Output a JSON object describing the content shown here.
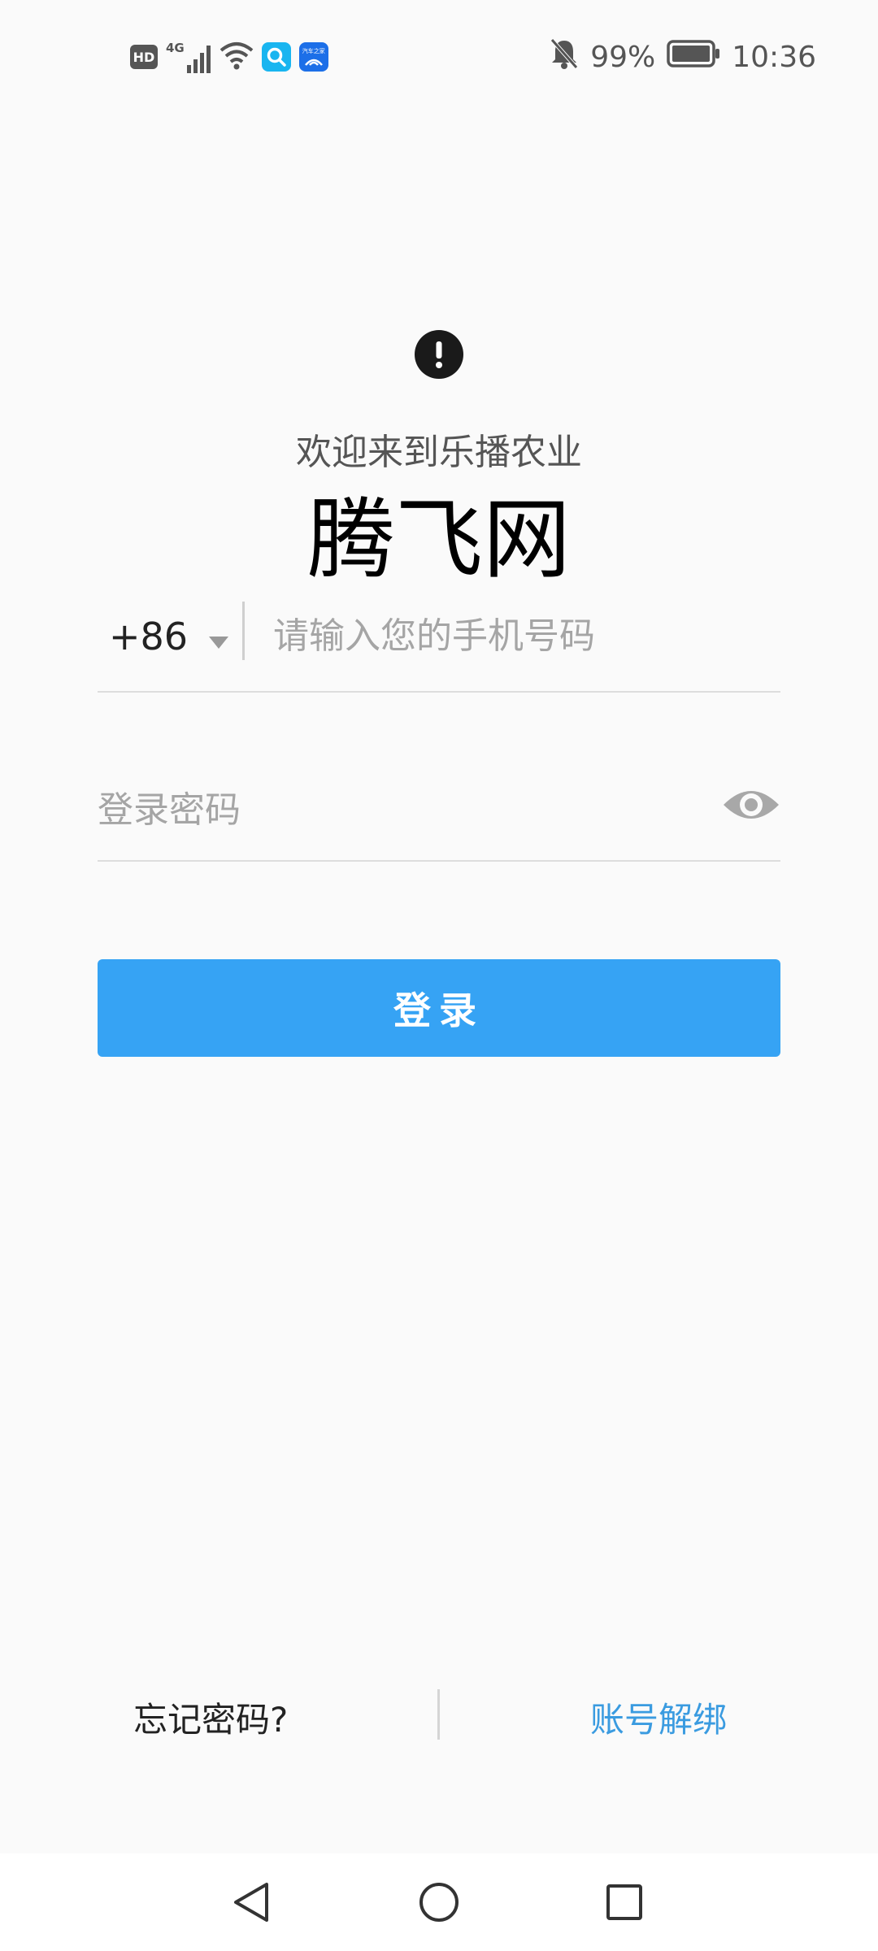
{
  "status_bar": {
    "hd_label": "HD",
    "network_label": "4G",
    "app_badge_text": "汽车之家",
    "battery_percent": "99%",
    "time": "10:36",
    "icons": [
      "hd-icon",
      "signal-4g-icon",
      "wifi-icon",
      "search-app-icon",
      "car-app-icon",
      "bell-muted-icon",
      "battery-icon"
    ]
  },
  "login": {
    "welcome_text": "欢迎来到乐播农业",
    "app_name": "腾飞网",
    "country_code": "+86",
    "phone_placeholder": "请输入您的手机号码",
    "phone_value": "",
    "password_placeholder": "登录密码",
    "password_value": "",
    "login_button": "登录"
  },
  "bottom_links": {
    "forgot_password": "忘记密码?",
    "unbind_account": "账号解绑"
  },
  "colors": {
    "background": "#FAFAFA",
    "accent": "#36A3F4",
    "link": "#3A9BE0",
    "placeholder": "#A5A5A5"
  }
}
